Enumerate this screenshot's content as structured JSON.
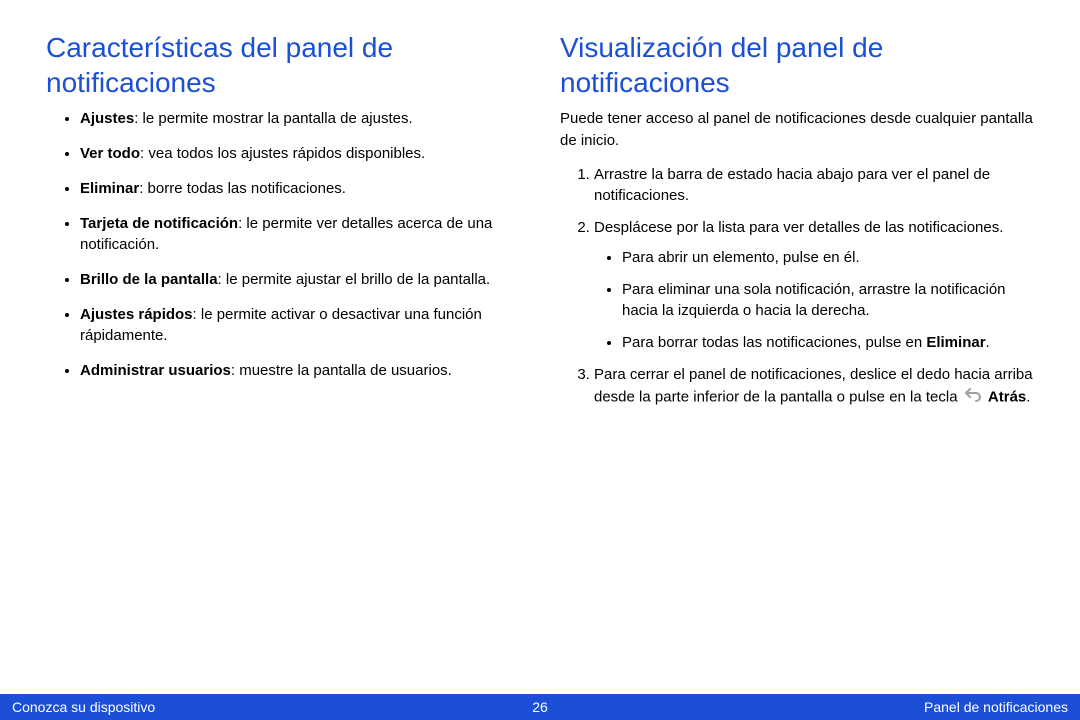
{
  "left": {
    "heading": "Características del panel de notificaciones",
    "items": [
      {
        "bold": "Ajustes",
        "rest": ": le permite mostrar la pantalla de ajustes."
      },
      {
        "bold": "Ver todo",
        "rest": ": vea todos los ajustes rápidos disponibles."
      },
      {
        "bold": "Eliminar",
        "rest": ": borre todas las notificaciones."
      },
      {
        "bold": "Tarjeta de notificación",
        "rest": ": le permite ver detalles acerca de una notificación."
      },
      {
        "bold": "Brillo de la pantalla",
        "rest": ": le permite ajustar el brillo de la pantalla."
      },
      {
        "bold": "Ajustes rápidos",
        "rest": ": le permite activar o desactivar una función rápidamente."
      },
      {
        "bold": "Administrar usuarios",
        "rest": ": muestre la pantalla de usuarios."
      }
    ]
  },
  "right": {
    "heading": "Visualización del panel de notificaciones",
    "intro": "Puede tener acceso al panel de notificaciones desde cualquier pantalla de inicio.",
    "steps": {
      "s1": "Arrastre la barra de estado hacia abajo para ver el panel de notificaciones.",
      "s2": "Desplácese por la lista para ver detalles de las notificaciones.",
      "s2sub": {
        "a": "Para abrir un elemento, pulse en él.",
        "b": "Para eliminar una sola notificación, arrastre la notificación hacia la izquierda o hacia la derecha.",
        "c_pre": "Para borrar todas las notificaciones, pulse en ",
        "c_bold": "Eliminar",
        "c_post": "."
      },
      "s3_pre": "Para cerrar el panel de notificaciones, deslice el dedo hacia arriba desde la parte inferior de la pantalla o pulse en la tecla ",
      "s3_bold": "Atrás",
      "s3_post": "."
    }
  },
  "footer": {
    "left": "Conozca su dispositivo",
    "center": "26",
    "right": "Panel de notificaciones"
  }
}
